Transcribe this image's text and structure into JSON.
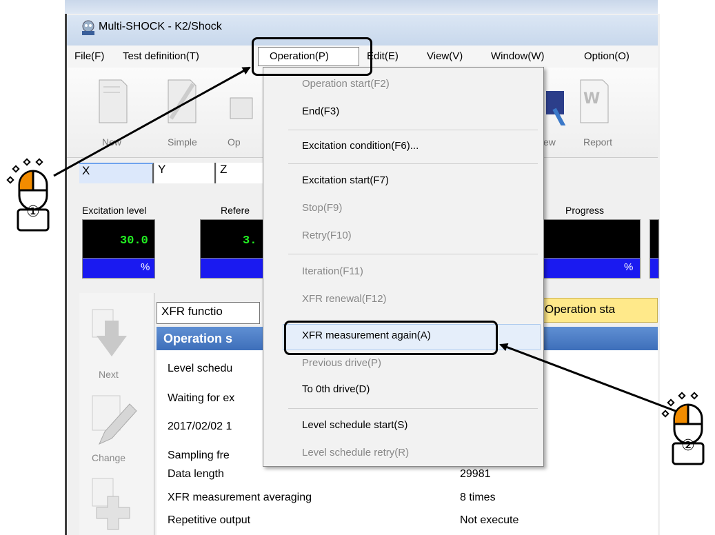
{
  "window": {
    "title": "Multi-SHOCK - K2/Shock"
  },
  "menubar": [
    "File(F)",
    "Test definition(T)",
    "Operation(P)",
    "Edit(E)",
    "View(V)",
    "Window(W)",
    "Option(O)"
  ],
  "toolbar": [
    "New",
    "Simple",
    "Op",
    "ew",
    "Report"
  ],
  "axis_tabs": [
    "X",
    "Y",
    "Z"
  ],
  "status_panels": {
    "excitation_level": {
      "label": "Excitation level",
      "value": "30.0",
      "unit": "%"
    },
    "reference": {
      "label": "Refere",
      "value": "3."
    },
    "progress": {
      "label": "Progress",
      "unit": "%"
    }
  },
  "side_panel": [
    "Next",
    "Change"
  ],
  "main": {
    "xfr_tab": "XFR functio",
    "operation_status_tab": "Operation sta",
    "header": "Operation s",
    "rows": [
      {
        "label": "Level schedu"
      },
      {
        "label": "Waiting for ex"
      },
      {
        "label": "2017/02/02 1"
      },
      {
        "label": "Sampling fre"
      },
      {
        "label": "Data length",
        "value": "29981"
      },
      {
        "label": "XFR measurement averaging",
        "value": "8 times"
      },
      {
        "label": "Repetitive output",
        "value": "Not execute"
      }
    ]
  },
  "dropdown": [
    {
      "label": "Operation start(F2)",
      "enabled": false
    },
    {
      "label": "End(F3)",
      "enabled": true
    },
    {
      "label": "Excitation condition(F6)...",
      "enabled": true
    },
    {
      "label": "Excitation start(F7)",
      "enabled": true
    },
    {
      "label": "Stop(F9)",
      "enabled": false
    },
    {
      "label": "Retry(F10)",
      "enabled": false
    },
    {
      "label": "Iteration(F11)",
      "enabled": false
    },
    {
      "label": "XFR renewal(F12)",
      "enabled": false
    },
    {
      "label": "XFR measurement again(A)",
      "enabled": true,
      "highlighted": true
    },
    {
      "label": "Previous drive(P)",
      "enabled": false
    },
    {
      "label": "To 0th drive(D)",
      "enabled": true
    },
    {
      "label": "Level schedule start(S)",
      "enabled": true
    },
    {
      "label": "Level schedule retry(R)",
      "enabled": false
    }
  ],
  "callouts": {
    "step1": "①",
    "step2": "②"
  },
  "colors": {
    "value_text": "#22ee22",
    "unit_bg": "#1a1af0",
    "header_bg": "#4a7bc4",
    "status_tab_bg": "#ffe98a",
    "mouse_button": "#f28c00"
  }
}
